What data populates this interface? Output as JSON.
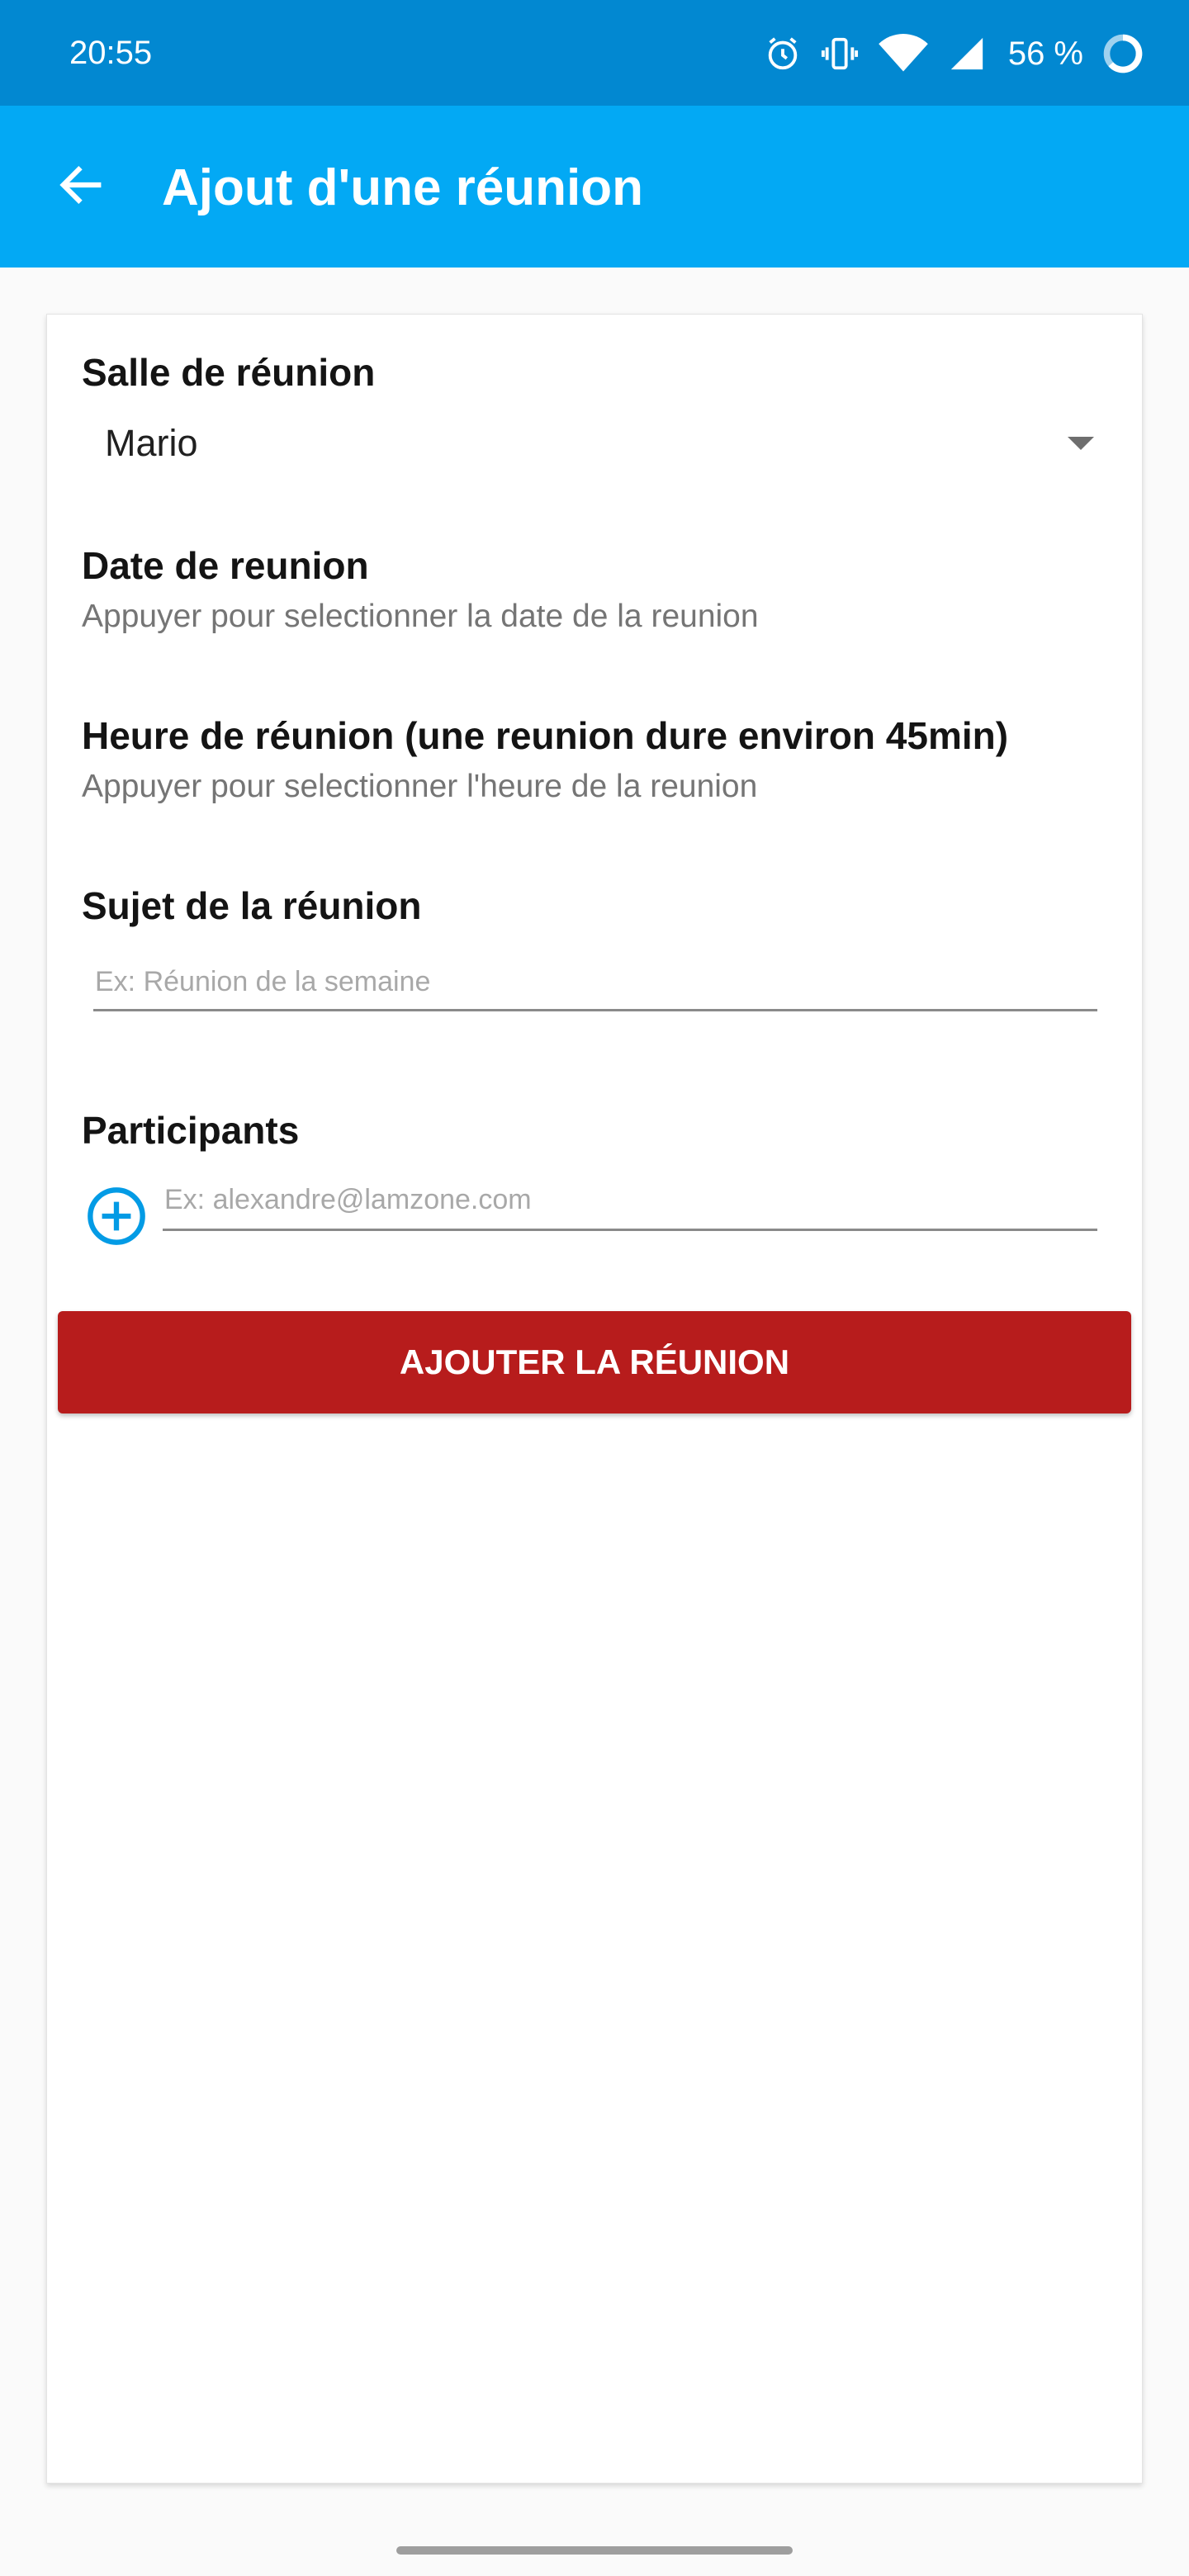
{
  "status_bar": {
    "time": "20:55",
    "battery_percent": "56 %",
    "icons": [
      "alarm-icon",
      "vibrate-icon",
      "wifi-icon",
      "cell-signal-icon",
      "battery-icon"
    ]
  },
  "app_bar": {
    "title": "Ajout d'une réunion",
    "back_icon": "arrow-back-icon",
    "background": "#03a9f4",
    "status_background": "#0288d1"
  },
  "form": {
    "room": {
      "label": "Salle de réunion",
      "selected": "Mario"
    },
    "date": {
      "label": "Date de reunion",
      "hint": "Appuyer pour selectionner la date de la reunion"
    },
    "time": {
      "label": "Heure de réunion (une reunion dure environ 45min)",
      "hint": "Appuyer pour selectionner l'heure de la reunion"
    },
    "subject": {
      "label": "Sujet de la réunion",
      "placeholder": "Ex: Réunion de la semaine",
      "value": ""
    },
    "participants": {
      "label": "Participants",
      "placeholder": "Ex: alexandre@lamzone.com",
      "value": "",
      "add_icon": "add-circle-icon"
    },
    "submit_label": "AJOUTER LA RÉUNION",
    "submit_color": "#b71c1c"
  }
}
